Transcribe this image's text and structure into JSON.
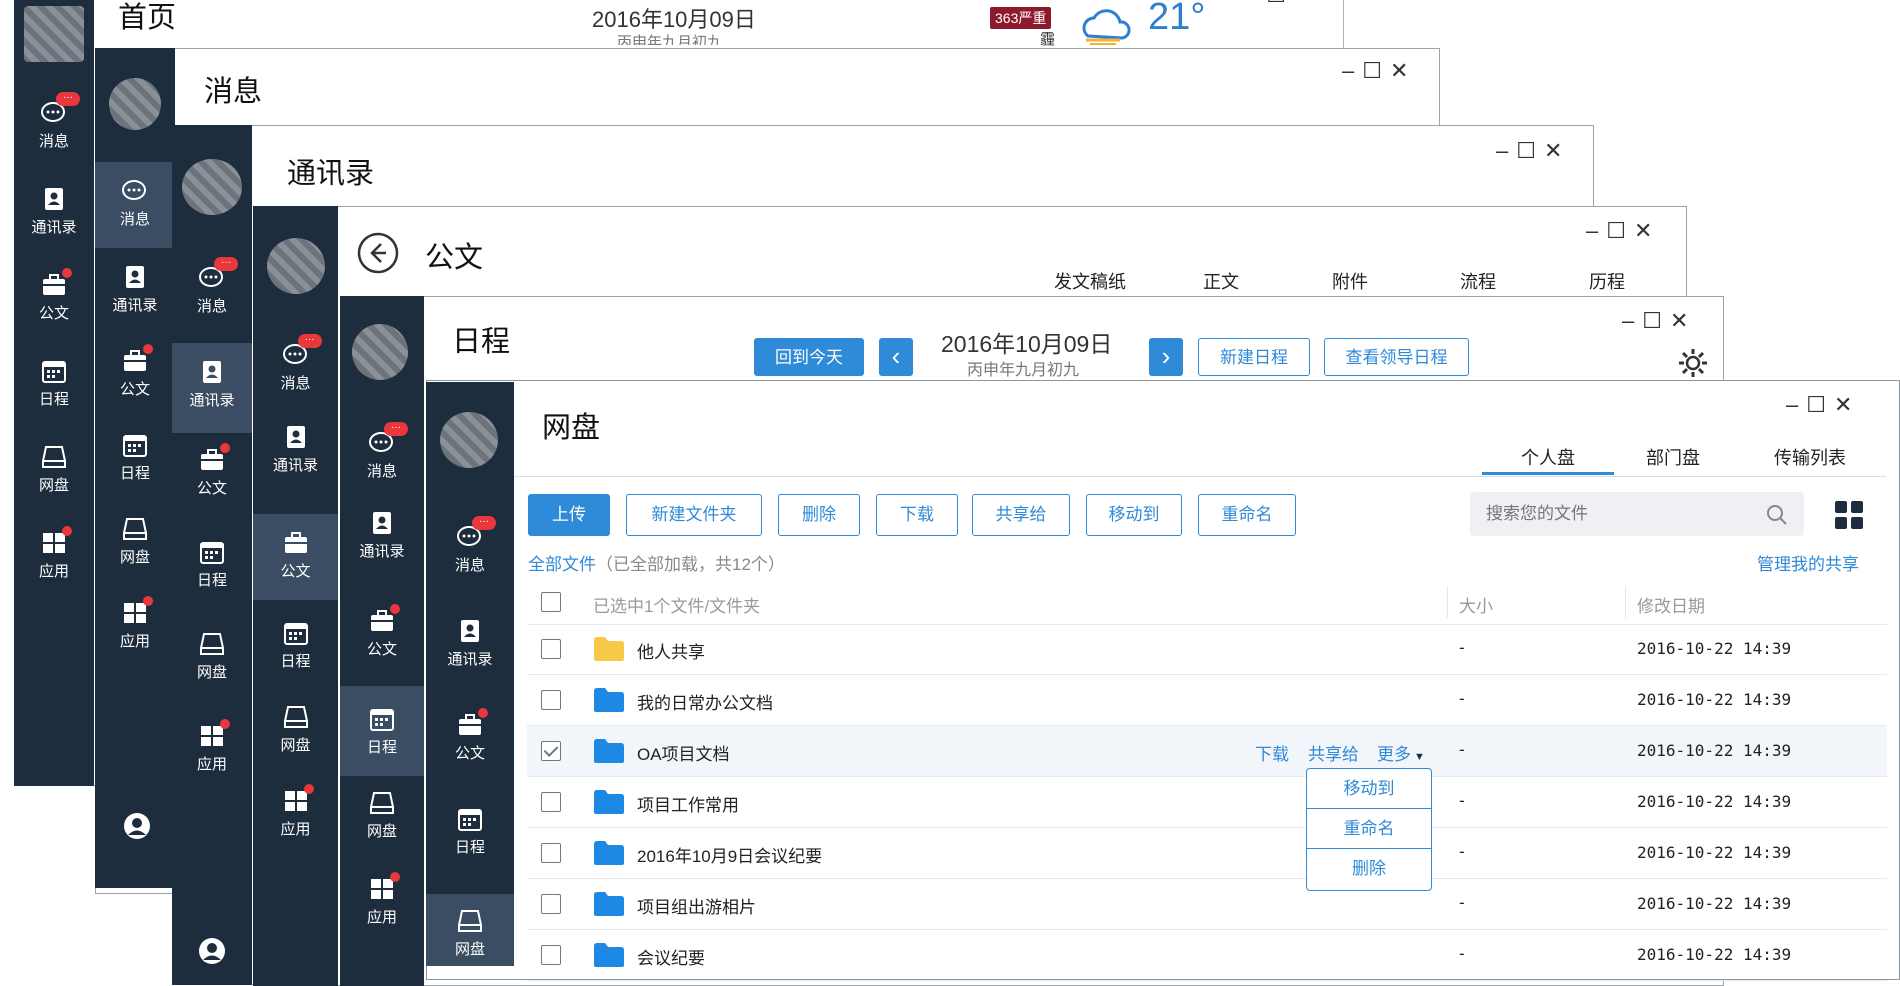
{
  "colors": {
    "sidebar": "#1e2d3e",
    "sidebar_active": "#3a4d62",
    "accent": "#2f8ad8",
    "badge": "#e8383d",
    "folder_blue": "#1e88e5",
    "folder_yellow": "#f7c948"
  },
  "sidebar_labels": {
    "messages": "消息",
    "contacts": "通讯录",
    "docs": "公文",
    "schedule": "日程",
    "disk": "网盘",
    "apps": "应用"
  },
  "badge_text": "···",
  "home": {
    "title": "首页",
    "date": "2016年10月09日",
    "lunar": "丙申年九月初九",
    "aqi": "363严重",
    "weather_icon": "cloud-sun-icon",
    "temp": "21°",
    "city_char": "霾"
  },
  "windows": {
    "messages_title": "消息",
    "contacts_title": "通讯录",
    "docs_title": "公文",
    "docs_tabs": [
      "发文稿纸",
      "正文",
      "附件",
      "流程",
      "历程"
    ],
    "schedule_title": "日程",
    "schedule": {
      "today_btn": "回到今天",
      "date": "2016年10月09日",
      "lunar": "丙申年九月初九",
      "new_btn": "新建日程",
      "leader_btn": "查看领导日程"
    },
    "disk_title": "网盘"
  },
  "disk": {
    "tabs": [
      "个人盘",
      "部门盘",
      "传输列表"
    ],
    "toolbar": [
      "上传",
      "新建文件夹",
      "删除",
      "下载",
      "共享给",
      "移动到",
      "重命名"
    ],
    "search_placeholder": "搜索您的文件",
    "breadcrumb": "全部文件",
    "loaded_info": "（已全部加载，共12个）",
    "manage_share": "管理我的共享",
    "header": {
      "selection": "已选中1个文件/文件夹",
      "size": "大小",
      "date": "修改日期"
    },
    "row_actions": {
      "download": "下载",
      "share": "共享给",
      "more": "更多"
    },
    "more_menu": [
      "移动到",
      "重命名",
      "删除"
    ],
    "rows": [
      {
        "name": "他人共享",
        "size": "-",
        "date": "2016-10-22 14:39",
        "checked": false,
        "type": "shared"
      },
      {
        "name": "我的日常办公文档",
        "size": "-",
        "date": "2016-10-22 14:39",
        "checked": false,
        "type": "folder"
      },
      {
        "name": "OA项目文档",
        "size": "-",
        "date": "2016-10-22 14:39",
        "checked": true,
        "type": "folder"
      },
      {
        "name": "项目工作常用",
        "size": "-",
        "date": "2016-10-22 14:39",
        "checked": false,
        "type": "folder"
      },
      {
        "name": "2016年10月9日会议纪要",
        "size": "-",
        "date": "2016-10-22 14:39",
        "checked": false,
        "type": "folder"
      },
      {
        "name": "项目组出游相片",
        "size": "-",
        "date": "2016-10-22 14:39",
        "checked": false,
        "type": "folder"
      },
      {
        "name": "会议纪要",
        "size": "-",
        "date": "2016-10-22 14:39",
        "checked": false,
        "type": "folder"
      }
    ]
  }
}
